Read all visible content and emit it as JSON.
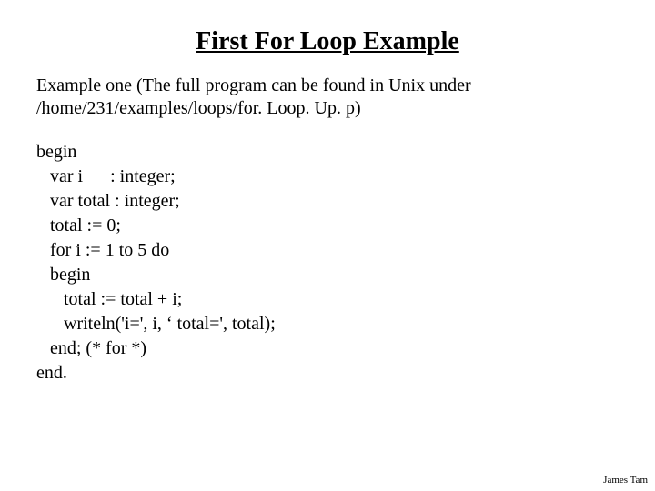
{
  "title": "First For Loop Example",
  "intro_line1": "Example  one (The full program can be found in Unix under",
  "intro_line2": "/home/231/examples/loops/for. Loop. Up. p)",
  "code": {
    "l1": "begin",
    "l2": "   var i      : integer;",
    "l3": "   var total : integer;",
    "l4": "   total := 0;",
    "l5": "   for i := 1 to 5 do",
    "l6": "   begin",
    "l7": "      total := total + i;",
    "l8": "      writeln('i=', i, ‘ total=', total);",
    "l9": "   end; (* for *)",
    "l10": "end."
  },
  "footer": "James Tam"
}
